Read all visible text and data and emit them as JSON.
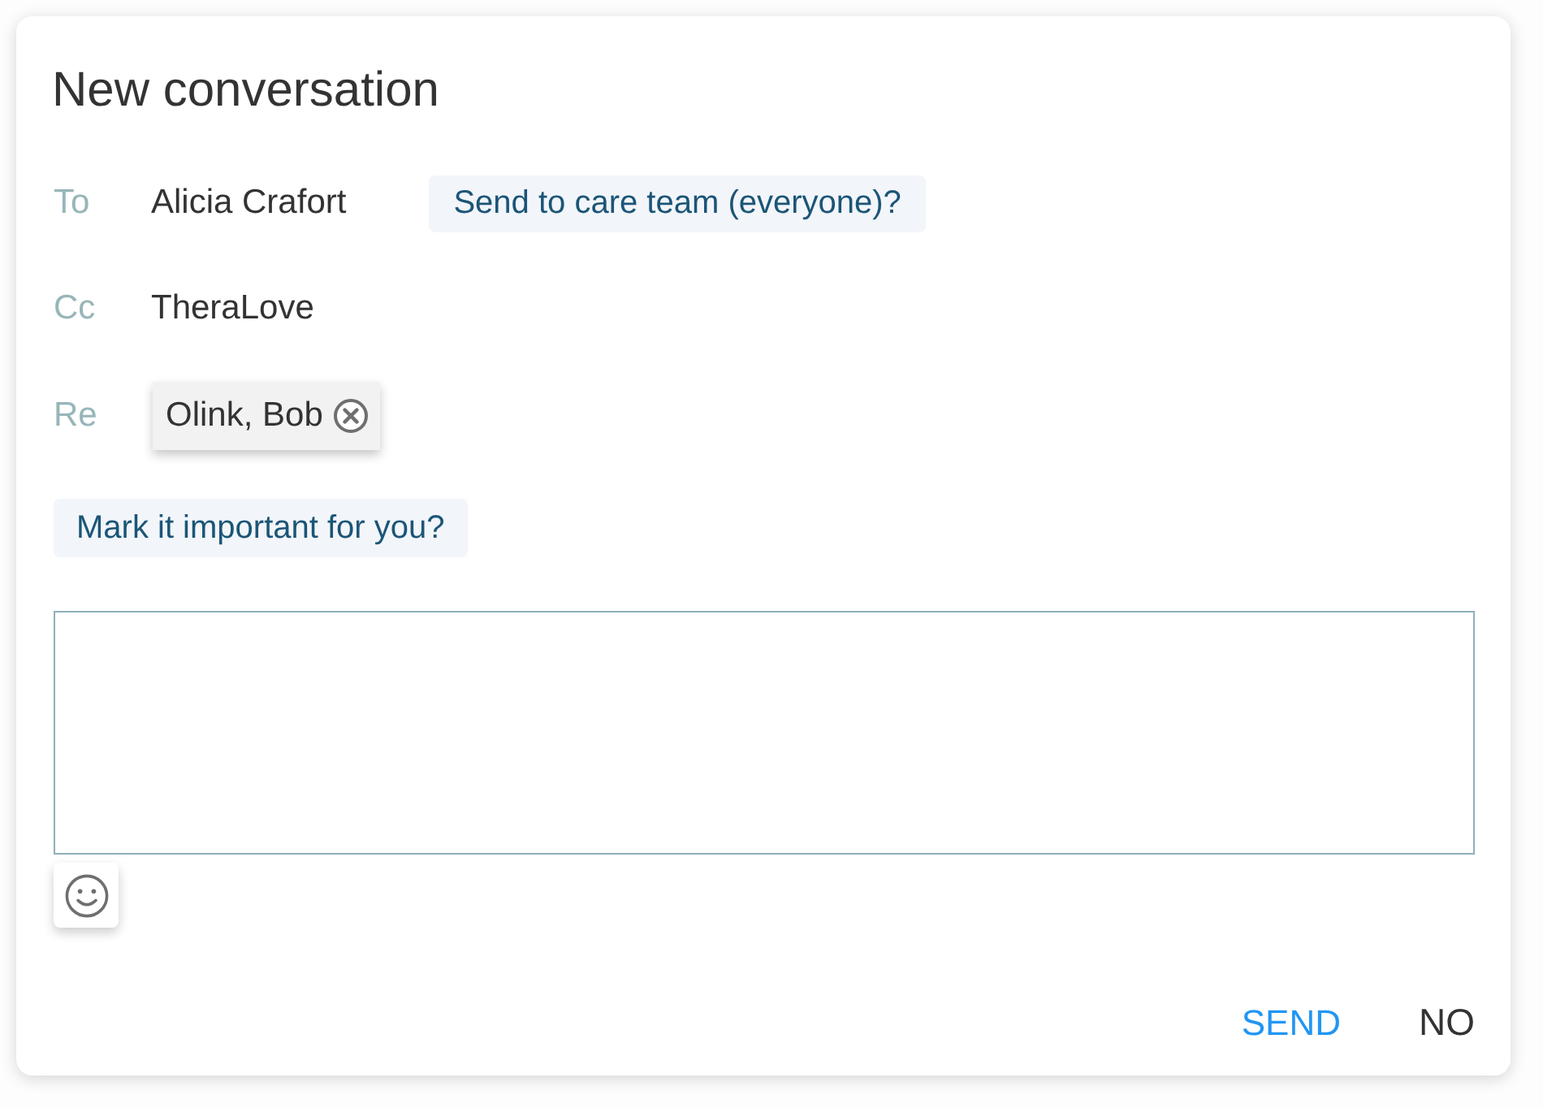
{
  "dialog": {
    "title": "New conversation"
  },
  "fields": [
    {
      "label": "To",
      "kind": "text",
      "value": "Alicia Crafort",
      "suggestion": "Send to care team (everyone)?"
    },
    {
      "label": "Cc",
      "kind": "text",
      "value": "TheraLove"
    },
    {
      "label": "Re",
      "kind": "chip",
      "value": "Olink, Bob"
    }
  ],
  "suggestion": "Mark it important for you?",
  "actions": [
    {
      "label": "SEND",
      "kind": "primary"
    },
    {
      "label": "NO",
      "kind": "secondary"
    }
  ]
}
